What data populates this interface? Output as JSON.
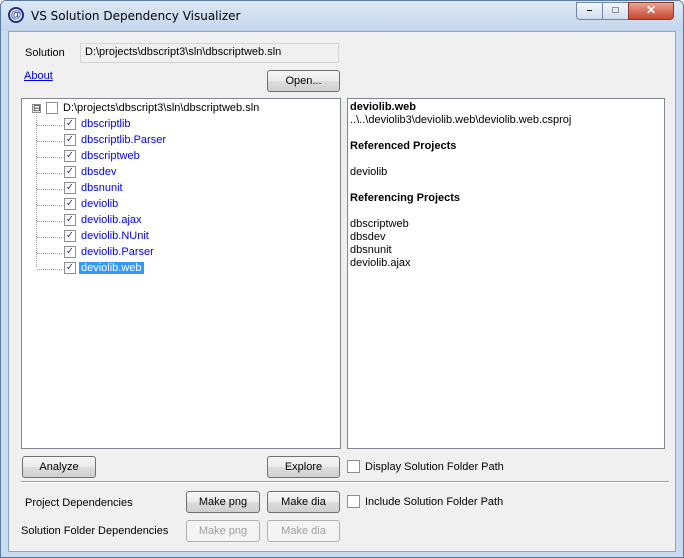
{
  "window": {
    "title": "VS Solution Dependency Visualizer",
    "icon": "at-sign-icon",
    "close_glyph": "✕",
    "max_glyph": "□",
    "min_glyph": "–"
  },
  "solution": {
    "label": "Solution",
    "path": "D:\\projects\\dbscript3\\sln\\dbscriptweb.sln",
    "about_link": "About",
    "open_button": "Open..."
  },
  "tree": {
    "expander": "⊟",
    "root": {
      "label": "D:\\projects\\dbscript3\\sln\\dbscriptweb.sln",
      "checked": false
    },
    "items": [
      {
        "label": "dbscriptlib",
        "checked": true
      },
      {
        "label": "dbscriptlib.Parser",
        "checked": true
      },
      {
        "label": "dbscriptweb",
        "checked": true
      },
      {
        "label": "dbsdev",
        "checked": true
      },
      {
        "label": "dbsnunit",
        "checked": true
      },
      {
        "label": "deviolib",
        "checked": true
      },
      {
        "label": "deviolib.ajax",
        "checked": true
      },
      {
        "label": "deviolib.NUnit",
        "checked": true
      },
      {
        "label": "deviolib.Parser",
        "checked": true
      },
      {
        "label": "deviolib.web",
        "checked": true,
        "selected": true
      }
    ],
    "check_glyph": "✓"
  },
  "details": {
    "project_name": "deviolib.web",
    "project_path": "..\\..\\deviolib3\\deviolib.web\\deviolib.web.csproj",
    "referenced_heading": "Referenced Projects",
    "referenced": [
      "deviolib"
    ],
    "referencing_heading": "Referencing Projects",
    "referencing": [
      "dbscriptweb",
      "dbsdev",
      "dbsnunit",
      "deviolib.ajax"
    ]
  },
  "actions": {
    "analyze_button": "Analyze",
    "explore_button": "Explore",
    "display_folder_path": {
      "label": "Display Solution Folder Path",
      "checked": false
    },
    "project_dependencies_label": "Project Dependencies",
    "make_png_button": "Make png",
    "make_dia_button": "Make dia",
    "include_folder_path": {
      "label": "Include Solution Folder Path",
      "checked": false
    },
    "folder_dependencies_label": "Solution Folder Dependencies",
    "folder_make_png_button": "Make png",
    "folder_make_dia_button": "Make dia"
  }
}
